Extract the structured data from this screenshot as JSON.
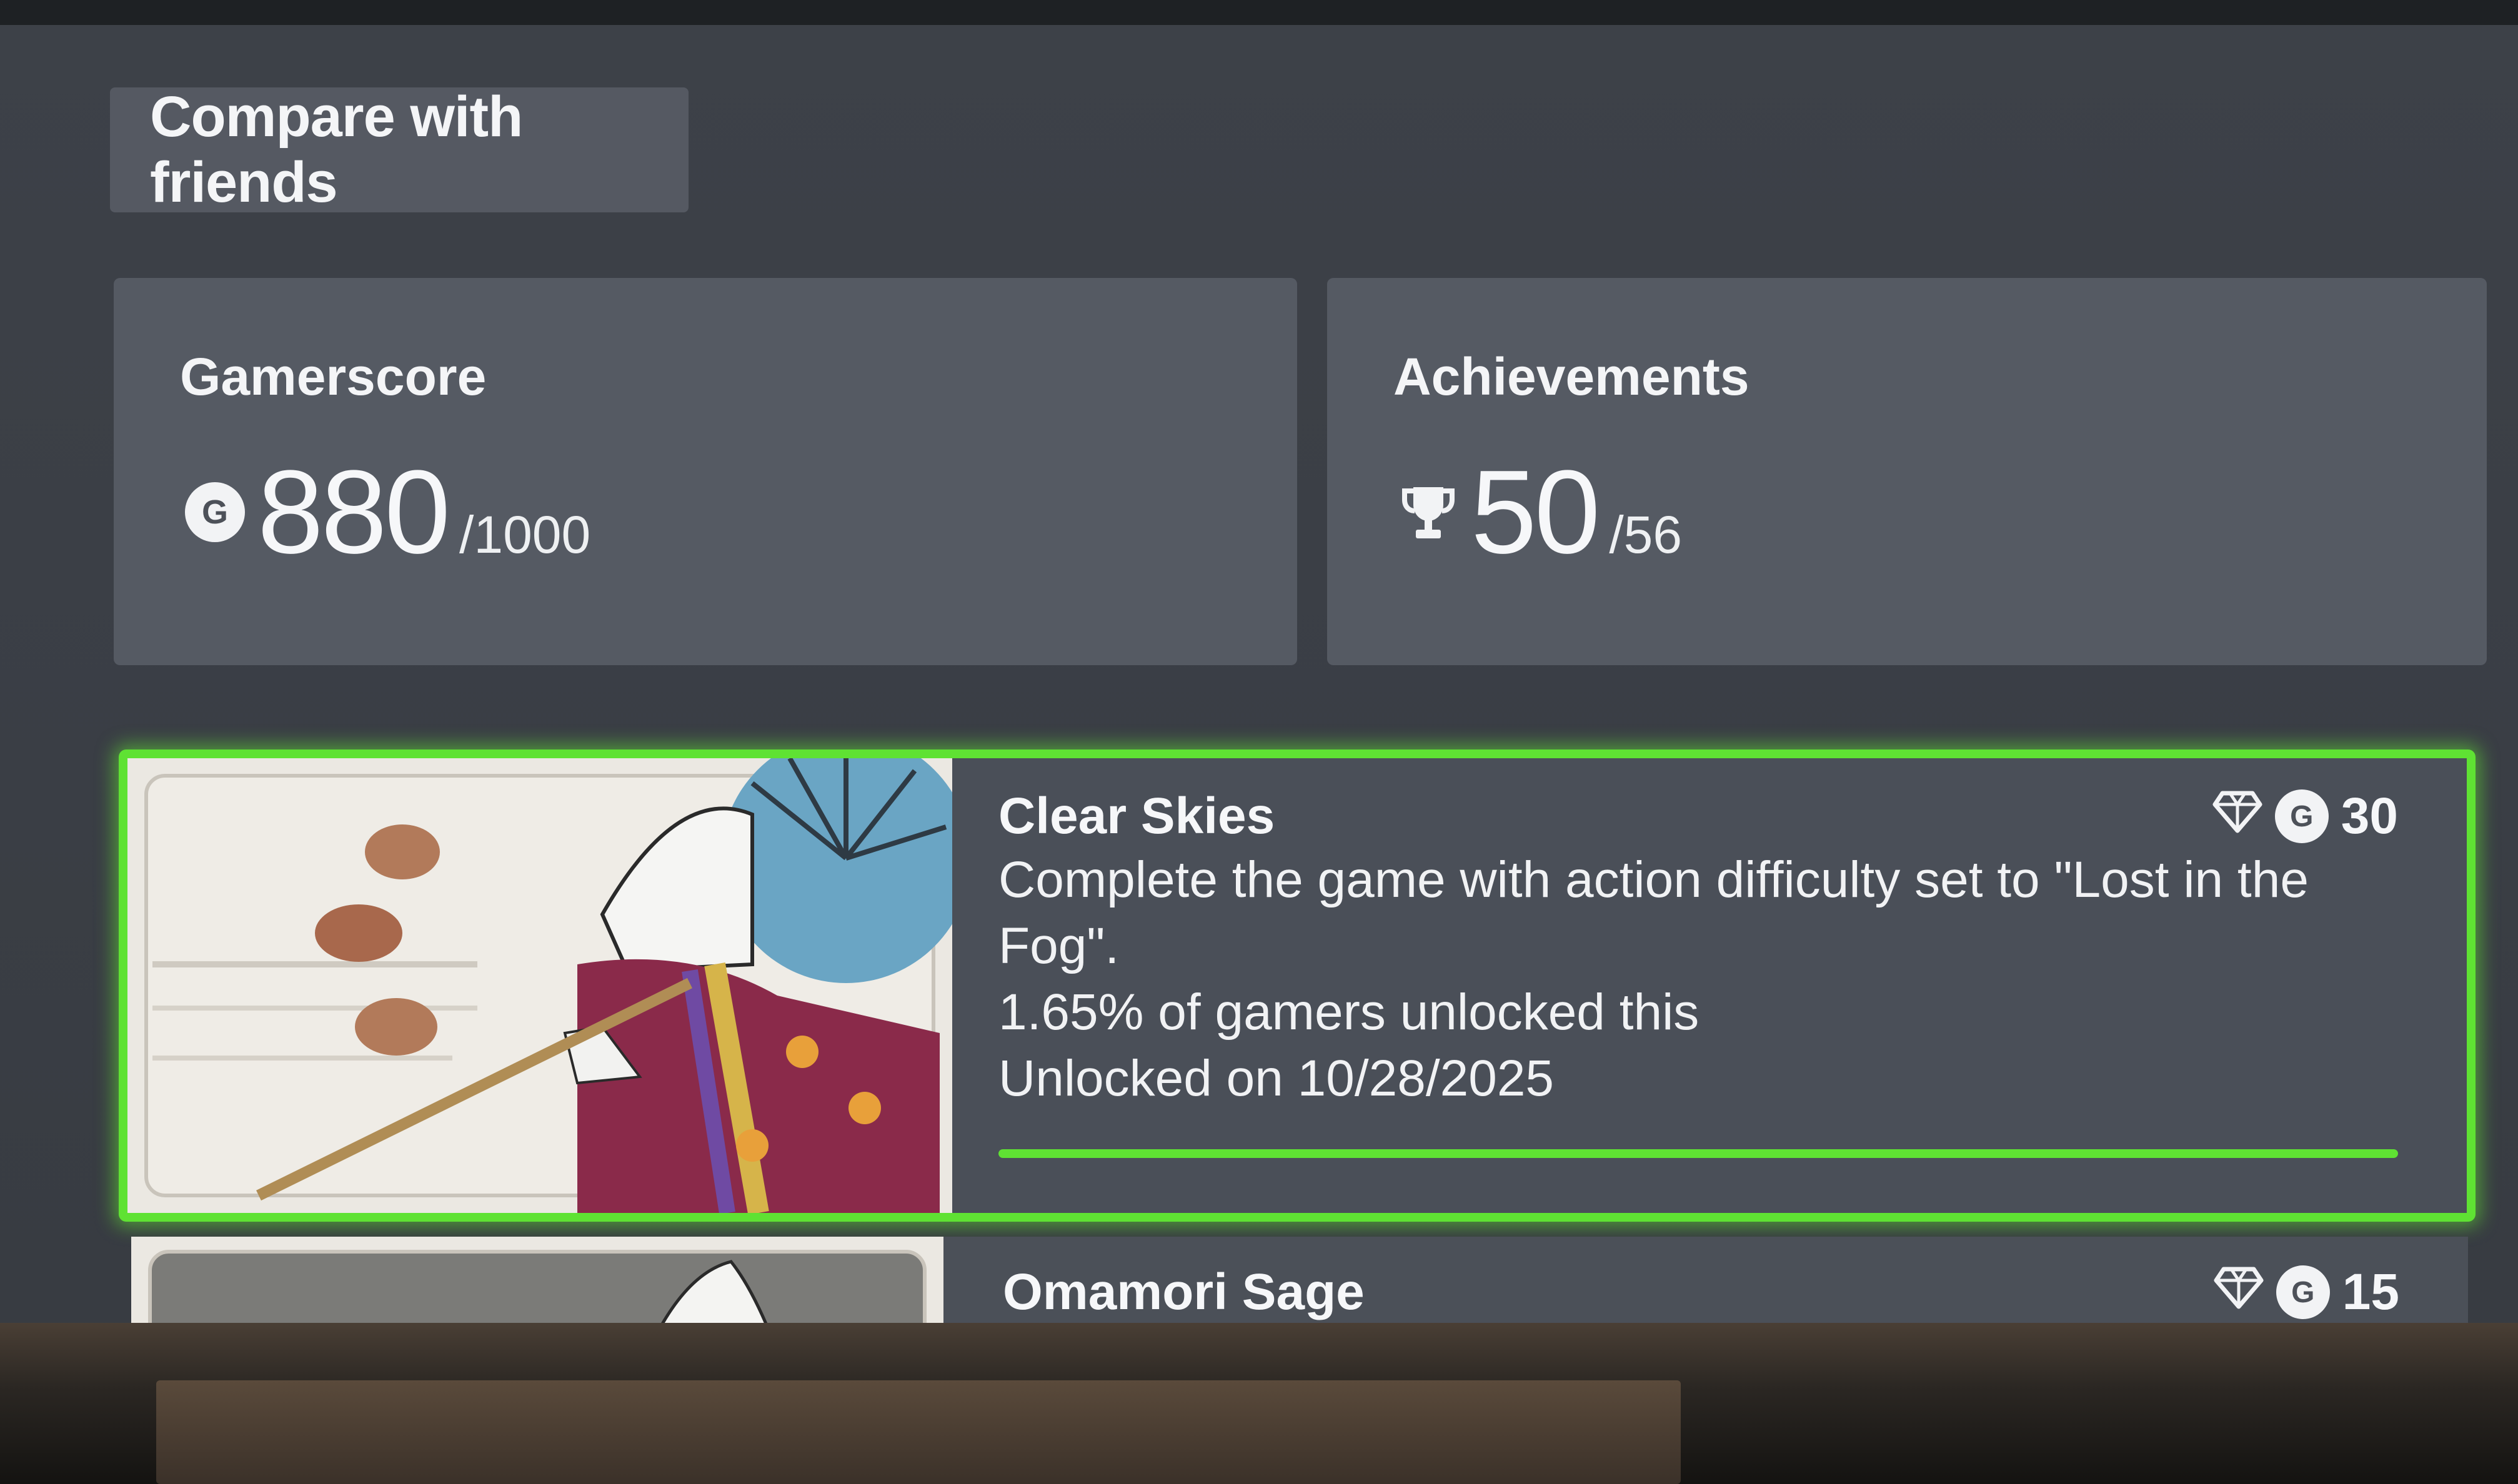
{
  "header": {
    "compare_label": "Compare with friends"
  },
  "stats": {
    "gamerscore": {
      "label": "Gamerscore",
      "icon": "gamerscore-icon",
      "badge": "G",
      "value": "880",
      "total": "/1000"
    },
    "achievements": {
      "label": "Achievements",
      "icon": "trophy-icon",
      "value": "50",
      "total": "/56"
    }
  },
  "achievements": [
    {
      "title": "Clear Skies",
      "description": "Complete the game with action difficulty set to \"Lost in the Fog\".",
      "rarity": "1.65% of gamers unlocked this",
      "unlocked": "Unlocked on 10/28/2025",
      "reward_badge": "G",
      "reward": "30",
      "progress": 1.0,
      "rare_icon": "diamond-icon"
    },
    {
      "title": "Omamori Sage",
      "reward_badge": "G",
      "reward": "15",
      "rare_icon": "diamond-icon"
    }
  ],
  "colors": {
    "accent": "#5fe233",
    "card": "#555a63",
    "screen": "#3d4148"
  }
}
